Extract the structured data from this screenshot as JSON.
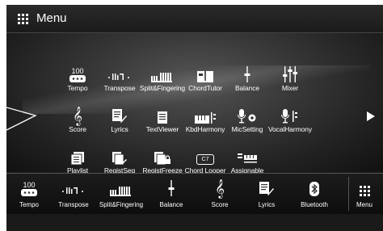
{
  "titlebar": {
    "title": "Menu"
  },
  "menu": {
    "row1": [
      {
        "label": "Tempo",
        "icon": "tempo-icon",
        "number": "100"
      },
      {
        "label": "Transpose",
        "icon": "transpose-icon"
      },
      {
        "label": "Split&Fingering",
        "icon": "split-fingering-icon"
      },
      {
        "label": "ChordTutor",
        "icon": "chord-tutor-icon"
      },
      {
        "label": "Balance",
        "icon": "balance-icon"
      },
      {
        "label": "Mixer",
        "icon": "mixer-icon"
      }
    ],
    "row2": [
      {
        "label": "Score",
        "icon": "score-icon"
      },
      {
        "label": "Lyrics",
        "icon": "lyrics-icon"
      },
      {
        "label": "TextViewer",
        "icon": "text-viewer-icon"
      },
      {
        "label": "KbdHarmony",
        "icon": "kbd-harmony-icon"
      },
      {
        "label": "MicSetting",
        "icon": "mic-setting-icon"
      },
      {
        "label": "VocalHarmony",
        "icon": "vocal-harmony-icon"
      }
    ],
    "row3": [
      {
        "label": "Playlist",
        "icon": "playlist-icon"
      },
      {
        "label": "RegistSeq",
        "icon": "regist-seq-icon"
      },
      {
        "label": "RegistFreeze",
        "icon": "regist-freeze-icon"
      },
      {
        "label": "Chord Looper",
        "icon": "chord-looper-icon",
        "badge": "C7"
      },
      {
        "label": "Assignable",
        "icon": "assignable-icon"
      }
    ]
  },
  "bottombar": {
    "items": [
      {
        "label": "Tempo",
        "icon": "tempo-icon",
        "number": "100"
      },
      {
        "label": "Transpose",
        "icon": "transpose-icon"
      },
      {
        "label": "Split&Fingering",
        "icon": "split-fingering-icon"
      },
      {
        "label": "Balance",
        "icon": "balance-icon"
      },
      {
        "label": "Score",
        "icon": "score-icon"
      },
      {
        "label": "Lyrics",
        "icon": "lyrics-icon"
      },
      {
        "label": "Bluetooth",
        "icon": "bluetooth-icon"
      },
      {
        "label": "Menu",
        "icon": "menu-grid-icon"
      }
    ]
  }
}
